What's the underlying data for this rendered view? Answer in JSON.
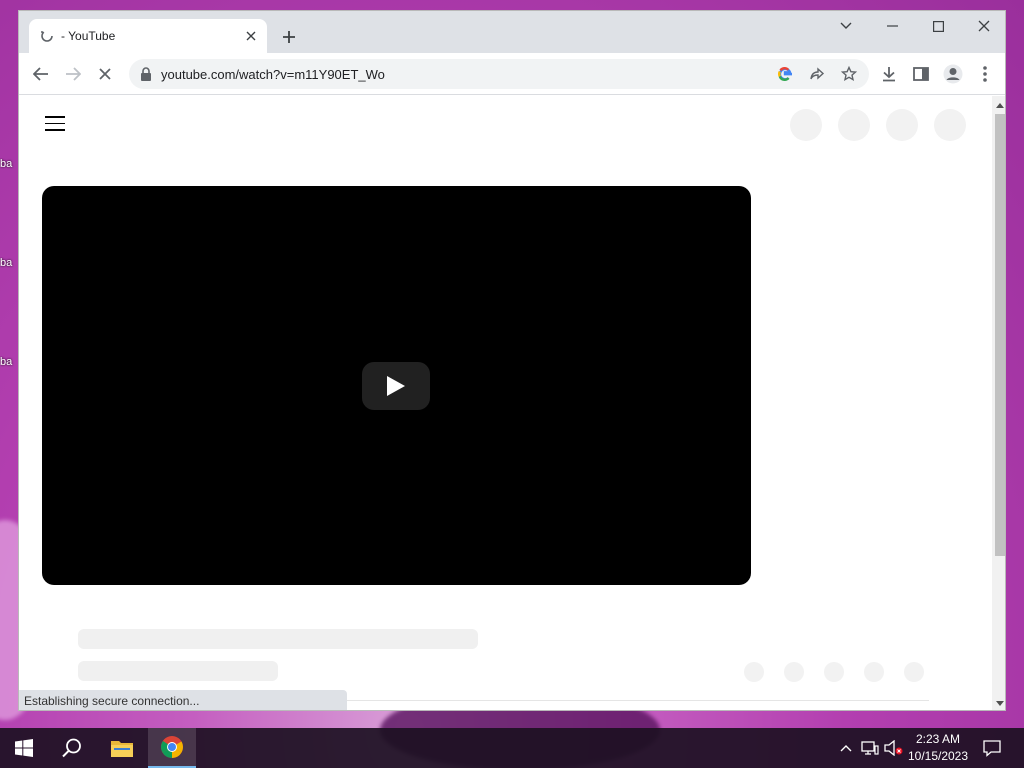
{
  "desktop": {
    "icon_label_prefix": "ba"
  },
  "browser": {
    "tab": {
      "title": " - YouTube"
    },
    "omnibox": {
      "url": "youtube.com/watch?v=m11Y90ET_Wo"
    },
    "status_text": "Establishing secure connection..."
  },
  "page": {
    "player": {
      "state": "loading"
    }
  },
  "taskbar": {
    "apps": [
      "start",
      "search",
      "file-explorer",
      "chrome"
    ],
    "active_app": "chrome",
    "clock": {
      "time": "2:23 AM",
      "date": "10/15/2023"
    }
  },
  "colors": {
    "tabstrip": "#dee1e6",
    "player_bg": "#000000",
    "skeleton": "#f0f0f0",
    "taskbar": "#1c1022"
  }
}
